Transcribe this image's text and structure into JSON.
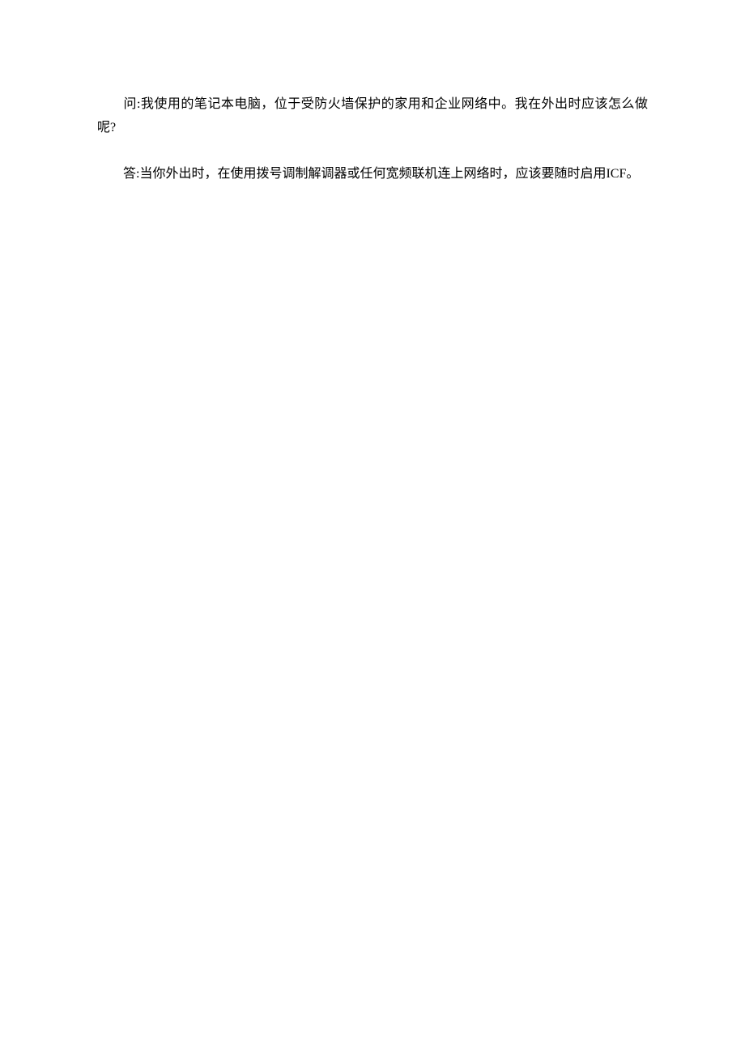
{
  "content": {
    "paragraph1": "问:我使用的笔记本电脑，位于受防火墙保护的家用和企业网络中。我在外出时应该怎么做呢?",
    "paragraph2": "答:当你外出时，在使用拨号调制解调器或任何宽频联机连上网络时，应该要随时启用ICF。"
  }
}
